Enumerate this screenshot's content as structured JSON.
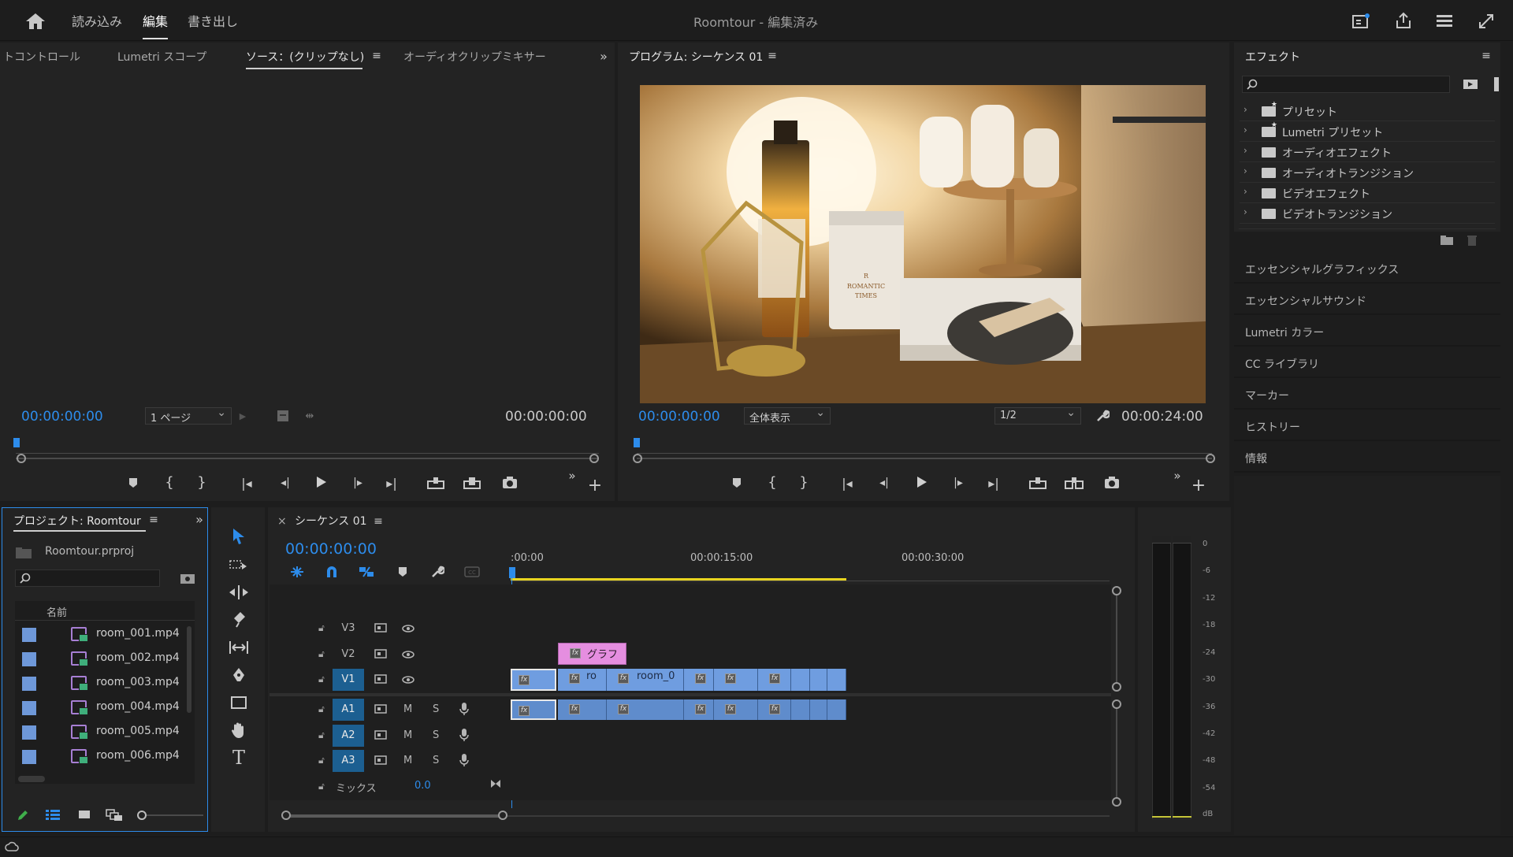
{
  "window": {
    "title": "Roomtour - 編集済み",
    "menu": [
      "読み込み",
      "編集",
      "書き出し"
    ]
  },
  "source_panel": {
    "tabs": [
      "トコントロール",
      "Lumetri スコープ",
      "ソース：(クリップなし)",
      "オーディオクリップミキサー"
    ],
    "timecode_in": "00:00:00:00",
    "timecode_out": "00:00:00:00",
    "page_select": "1 ページ"
  },
  "program_panel": {
    "title": "プログラム: シーケンス 01",
    "timecode_in": "00:00:00:00",
    "timecode_out": "00:00:24:00",
    "zoom": "全体表示",
    "resolution": "1/2",
    "preview_text": [
      "R",
      "ROMANTIC",
      "TIMES"
    ]
  },
  "effects_panel": {
    "title": "エフェクト",
    "items": [
      "プリセット",
      "Lumetri プリセット",
      "オーディオエフェクト",
      "オーディオトランジション",
      "ビデオエフェクト",
      "ビデオトランジション"
    ]
  },
  "side_panels": [
    "エッセンシャルグラフィックス",
    "エッセンシャルサウンド",
    "Lumetri カラー",
    "CC ライブラリ",
    "マーカー",
    "ヒストリー",
    "情報"
  ],
  "project_panel": {
    "title": "プロジェクト: Roomtour",
    "file": "Roomtour.prproj",
    "column_header": "名前",
    "items": [
      "room_001.mp4",
      "room_002.mp4",
      "room_003.mp4",
      "room_004.mp4",
      "room_005.mp4",
      "room_006.mp4"
    ]
  },
  "timeline": {
    "sequence": "シーケンス 01",
    "close": "×",
    "timecode": "00:00:00:00",
    "ruler": [
      ":00:00",
      "00:00:15:00",
      "00:00:30:00"
    ],
    "tracks": [
      "V3",
      "V2",
      "V1",
      "A1",
      "A2",
      "A3"
    ],
    "mute_label": "M",
    "solo_label": "S",
    "mix_label": "ミックス",
    "mix_value": "0.0",
    "graphic_clip_label": "グラフ",
    "video_clip_labels": [
      "ro",
      "room_0"
    ]
  },
  "audio_meter": {
    "scale": [
      "0",
      "-6",
      "-12",
      "-18",
      "-24",
      "-30",
      "-36",
      "-42",
      "-48",
      "-54",
      "dB"
    ]
  },
  "colors": {
    "accent_blue": "#2d8ceb",
    "clip_video": "#6f9de0",
    "clip_graphic": "#e58ee0",
    "work_area": "#e8d41f",
    "track_target": "#1c5f91"
  }
}
